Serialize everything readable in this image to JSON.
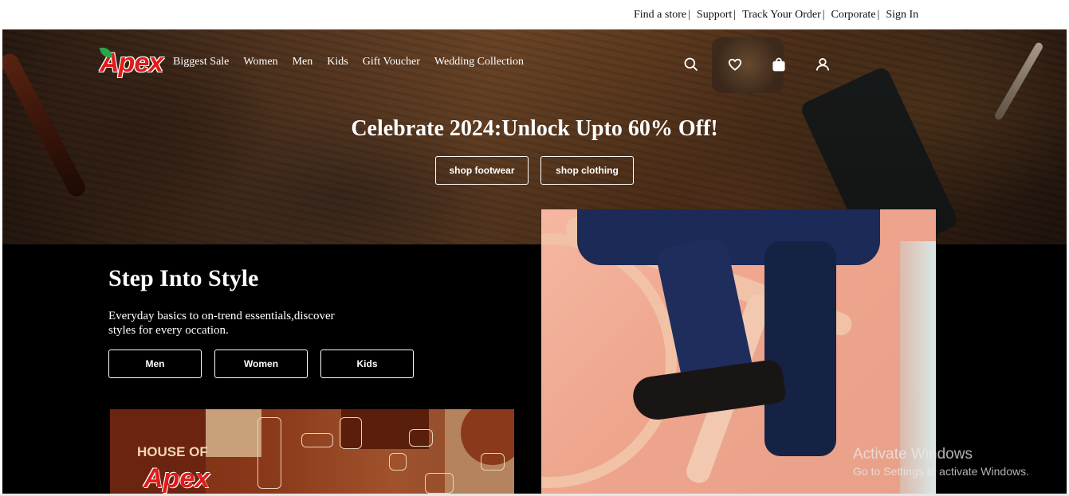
{
  "utility": {
    "links": [
      "Find a store",
      "Support",
      "Track Your Order",
      "Corporate",
      "Sign In"
    ],
    "separator": "|"
  },
  "brand": {
    "logo_text": "Apex"
  },
  "nav": {
    "items": [
      "Biggest Sale",
      "Women",
      "Men",
      "Kids",
      "Gift Voucher",
      "Wedding Collection"
    ],
    "icons": [
      "search-icon",
      "heart-icon",
      "shopping-bag-icon",
      "user-icon"
    ]
  },
  "hero": {
    "title": "Celebrate 2024:Unlock Upto 60% Off!",
    "buttons": [
      "shop footwear",
      "shop clothing"
    ]
  },
  "style_section": {
    "title": "Step Into Style",
    "description": "Everyday basics to on-trend essentials,discover styles for every occation.",
    "buttons": [
      "Men",
      "Women",
      "Kids"
    ]
  },
  "promo": {
    "house_of": "HOUSE OF",
    "logo_text": "Apex"
  },
  "watermark": {
    "line1": "Activate Windows",
    "line2": "Go to Settings to activate Windows."
  },
  "colors": {
    "brand_red": "#e21a1a",
    "section_bg": "#000000",
    "text_light": "#ffffff"
  }
}
